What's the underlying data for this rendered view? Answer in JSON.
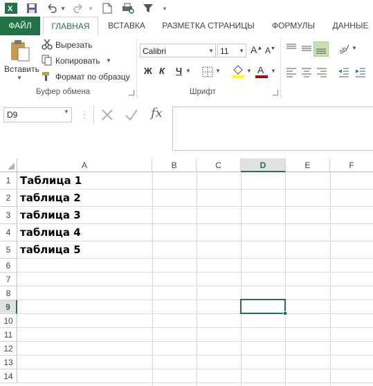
{
  "quick_access": {
    "items": [
      "excel-logo-icon",
      "save-icon",
      "undo-icon",
      "redo-icon",
      "new-document-icon",
      "print-preview-icon",
      "filter-icon",
      "customize-qat-icon"
    ]
  },
  "tabs": [
    "ФАЙЛ",
    "ГЛАВНАЯ",
    "ВСТАВКА",
    "РАЗМЕТКА СТРАНИЦЫ",
    "ФОРМУЛЫ",
    "ДАННЫЕ"
  ],
  "clipboard": {
    "paste_label": "Вставить",
    "cut_label": "Вырезать",
    "copy_label": "Копировать",
    "format_painter_label": "Формат по образцу",
    "group_label": "Буфер обмена"
  },
  "font": {
    "font_name": "Calibri",
    "font_size": "11",
    "bold_label": "Ж",
    "italic_label": "К",
    "underline_label": "Ч",
    "grow_label": "A",
    "shrink_label": "A",
    "color_label": "A",
    "group_label": "Шрифт"
  },
  "formula_bar": {
    "name_box": "D9",
    "fx_label": "fx",
    "value": ""
  },
  "columns": [
    "A",
    "B",
    "C",
    "D",
    "E",
    "F"
  ],
  "selected_column": "D",
  "rows": [
    "1",
    "2",
    "3",
    "4",
    "5",
    "6",
    "7",
    "8",
    "9",
    "10",
    "11",
    "12",
    "13",
    "14"
  ],
  "selected_row": "9",
  "cells": {
    "A1": "Таблица 1",
    "A2": "таблица 2",
    "A3": "таблица 3",
    "A4": "таблица 4",
    "A5": "таблица 5"
  },
  "colors": {
    "accent": "#217346",
    "fill_swatch": "#ffff00",
    "font_color_swatch": "#c00000"
  }
}
